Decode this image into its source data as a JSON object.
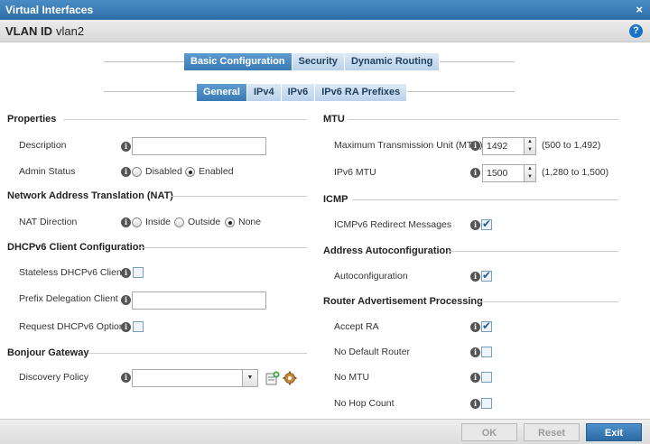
{
  "window": {
    "title": "Virtual Interfaces",
    "close": "×"
  },
  "vlan": {
    "label": "VLAN ID",
    "value": "vlan2",
    "help": "?"
  },
  "tabs": {
    "main": [
      "Basic Configuration",
      "Security",
      "Dynamic Routing"
    ],
    "sub": [
      "General",
      "IPv4",
      "IPv6",
      "IPv6 RA Prefixes"
    ]
  },
  "left": {
    "properties": {
      "title": "Properties",
      "description_label": "Description",
      "description_value": "",
      "admin_status_label": "Admin Status",
      "admin_status_options": [
        "Disabled",
        "Enabled"
      ],
      "admin_status_selected": "Enabled"
    },
    "nat": {
      "title": "Network Address Translation (NAT)",
      "direction_label": "NAT Direction",
      "direction_options": [
        "Inside",
        "Outside",
        "None"
      ],
      "direction_selected": "None"
    },
    "dhcpv6": {
      "title": "DHCPv6 Client Configuration",
      "stateless_label": "Stateless DHCPv6 Client",
      "stateless_checked": false,
      "prefix_label": "Prefix Delegation Client",
      "prefix_value": "",
      "request_label": "Request DHCPv6 Options",
      "request_checked": false
    },
    "bonjour": {
      "title": "Bonjour Gateway",
      "discovery_label": "Discovery Policy",
      "discovery_value": ""
    }
  },
  "right": {
    "mtu": {
      "title": "MTU",
      "max_label": "Maximum Transmission Unit (MTU)",
      "max_value": "1492",
      "max_range": "(500 to 1,492)",
      "ipv6_label": "IPv6 MTU",
      "ipv6_value": "1500",
      "ipv6_range": "(1,280 to 1,500)"
    },
    "icmp": {
      "title": "ICMP",
      "redirect_label": "ICMPv6 Redirect Messages",
      "redirect_checked": true
    },
    "autoconf": {
      "title": "Address Autoconfiguration",
      "auto_label": "Autoconfiguration",
      "auto_checked": true
    },
    "rap": {
      "title": "Router Advertisement Processing",
      "accept_ra_label": "Accept RA",
      "accept_ra_checked": true,
      "no_default_router_label": "No Default Router",
      "no_default_router_checked": false,
      "no_mtu_label": "No MTU",
      "no_mtu_checked": false,
      "no_hop_count_label": "No Hop Count",
      "no_hop_count_checked": false
    }
  },
  "footer": {
    "ok": "OK",
    "reset": "Reset",
    "exit": "Exit"
  },
  "colors": {
    "accent": "#3a7bb6",
    "title_bar": "#2d6ea8"
  }
}
